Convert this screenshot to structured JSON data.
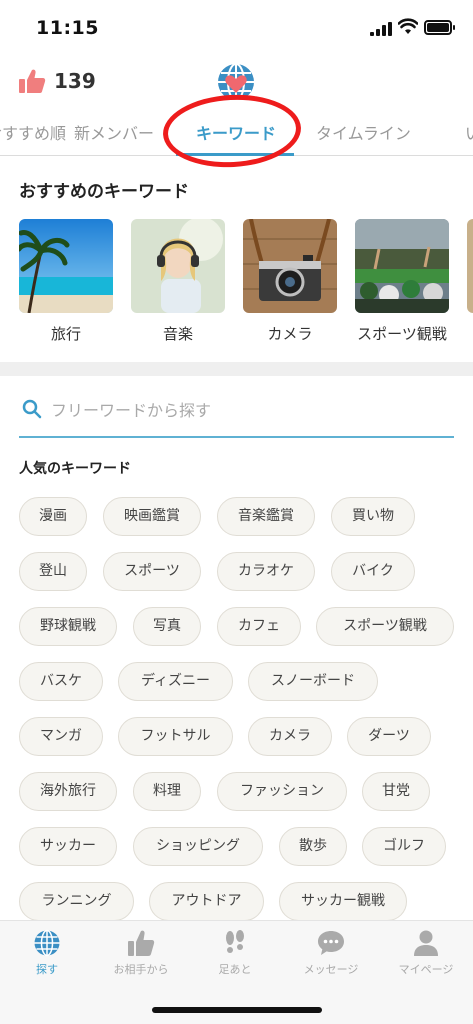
{
  "status_bar": {
    "time": "11:15"
  },
  "header": {
    "like_count": "139"
  },
  "tabs": [
    {
      "label": "おすすめ順"
    },
    {
      "label": "新メンバー"
    },
    {
      "label": "キーワード",
      "active": true
    },
    {
      "label": "タイムライン"
    },
    {
      "label": "い"
    }
  ],
  "recommended": {
    "title": "おすすめのキーワード",
    "items": [
      {
        "label": "旅行"
      },
      {
        "label": "音楽"
      },
      {
        "label": "カメラ"
      },
      {
        "label": "スポーツ観戦"
      }
    ]
  },
  "search": {
    "placeholder": "フリーワードから探す"
  },
  "popular": {
    "title": "人気のキーワード",
    "rows": [
      [
        "漫画",
        "映画鑑賞",
        "音楽鑑賞",
        "買い物"
      ],
      [
        "登山",
        "スポーツ",
        "カラオケ",
        "バイク"
      ],
      [
        "野球観戦",
        "写真",
        "カフェ",
        "スポーツ観戦"
      ],
      [
        "バスケ",
        "ディズニー",
        "スノーボード"
      ],
      [
        "マンガ",
        "フットサル",
        "カメラ",
        "ダーツ"
      ],
      [
        "海外旅行",
        "料理",
        "ファッション",
        "甘党"
      ],
      [
        "サッカー",
        "ショッピング",
        "散歩",
        "ゴルフ"
      ],
      [
        "ランニング",
        "アウトドア",
        "サッカー観戦"
      ]
    ]
  },
  "bottom_nav": [
    {
      "label": "探す",
      "icon": "globe-icon",
      "active": true
    },
    {
      "label": "お相手から",
      "icon": "thumbs-up-icon"
    },
    {
      "label": "足あと",
      "icon": "footprints-icon"
    },
    {
      "label": "メッセージ",
      "icon": "chat-bubble-icon"
    },
    {
      "label": "マイページ",
      "icon": "person-icon"
    }
  ],
  "colors": {
    "accent": "#3b9bc9",
    "like": "#f07e7e",
    "highlight": "#ee1c1c"
  }
}
